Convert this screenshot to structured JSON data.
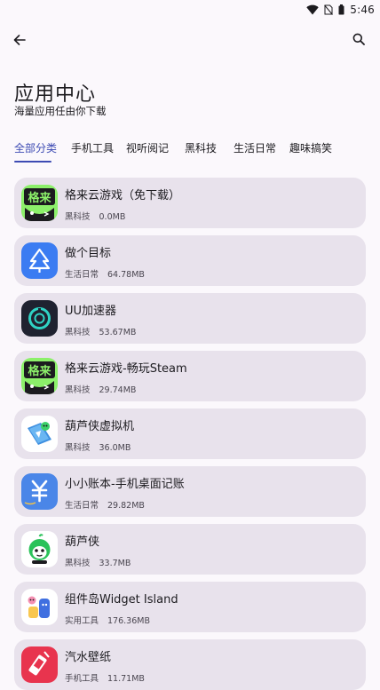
{
  "status_bar": {
    "time": "5:46"
  },
  "header": {
    "title": "应用中心",
    "subtitle": "海量应用任由你下载"
  },
  "tabs": [
    {
      "label": "全部分类",
      "active": true
    },
    {
      "label": "手机工具",
      "active": false
    },
    {
      "label": "视听阅记",
      "active": false
    },
    {
      "label": "黑科技",
      "active": false
    },
    {
      "label": "生活日常",
      "active": false
    },
    {
      "label": "趣味搞笑",
      "active": false
    }
  ],
  "apps": [
    {
      "name": "格来云游戏（免下载）",
      "category": "黑科技",
      "size": "0.0MB",
      "icon": "gelai-cloud-game-icon"
    },
    {
      "name": "做个目标",
      "category": "生活日常",
      "size": "64.78MB",
      "icon": "tree-target-icon"
    },
    {
      "name": "UU加速器",
      "category": "黑科技",
      "size": "53.67MB",
      "icon": "uu-accelerator-icon"
    },
    {
      "name": "格来云游戏-畅玩Steam",
      "category": "黑科技",
      "size": "29.74MB",
      "icon": "gelai-cloud-game-icon"
    },
    {
      "name": "葫芦侠虚拟机",
      "category": "黑科技",
      "size": "36.0MB",
      "icon": "huluxia-vm-icon"
    },
    {
      "name": "小小账本-手机桌面记账",
      "category": "生活日常",
      "size": "29.82MB",
      "icon": "yuan-ledger-icon"
    },
    {
      "name": "葫芦侠",
      "category": "黑科技",
      "size": "33.7MB",
      "icon": "huluxia-icon"
    },
    {
      "name": "组件岛Widget Island",
      "category": "实用工具",
      "size": "176.36MB",
      "icon": "widget-island-icon"
    },
    {
      "name": "汽水壁纸",
      "category": "手机工具",
      "size": "11.71MB",
      "icon": "soda-wallpaper-icon"
    }
  ],
  "colors": {
    "background": "#FBF8FC",
    "card": "#E8E2EC",
    "accent": "#3D4BB3",
    "text": "#1C1B1F",
    "secondary_text": "#49454F"
  }
}
